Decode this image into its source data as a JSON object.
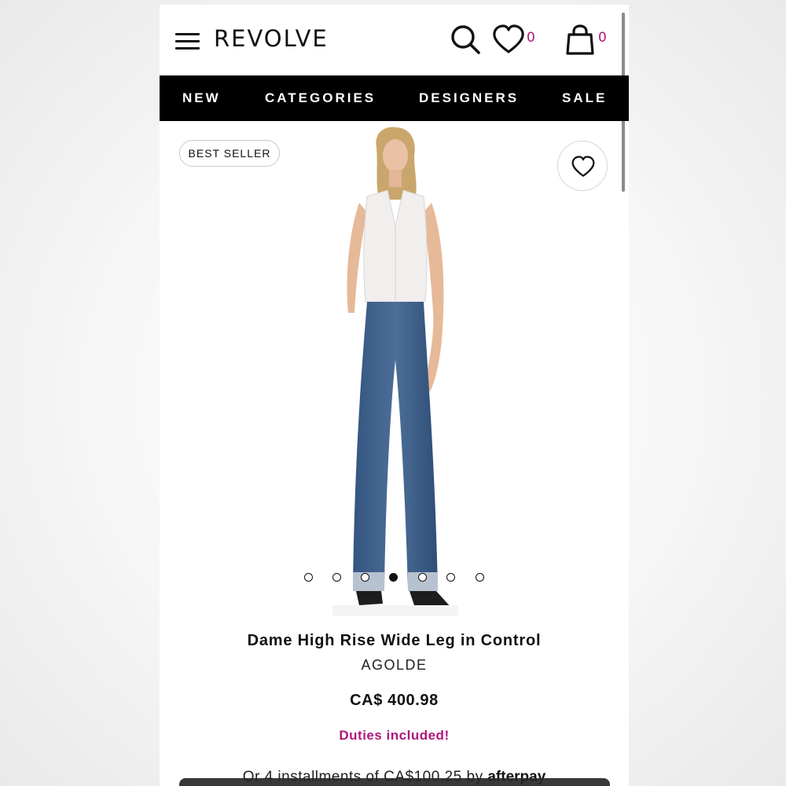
{
  "header": {
    "logo": "REVOLVE",
    "menu_icon": "hamburger-menu-icon",
    "search_icon": "search-icon",
    "wishlist_icon": "heart-icon",
    "wishlist_count": "0",
    "bag_icon": "shopping-bag-icon",
    "bag_count": "0",
    "count_color": "#b0177b"
  },
  "nav": {
    "items": [
      {
        "label": "NEW"
      },
      {
        "label": "CATEGORIES"
      },
      {
        "label": "DESIGNERS"
      },
      {
        "label": "SALE"
      }
    ]
  },
  "product": {
    "badge": "BEST SELLER",
    "favorite_icon": "heart-outline-icon",
    "image_description_icon": "product-photo",
    "title": "Dame High Rise Wide Leg in Control",
    "brand": "AGOLDE",
    "price": "CA$ 400.98",
    "duties": "Duties included!",
    "installments_text": "Or 4 installments of CA$100.25 by ",
    "installments_provider": "afterpay",
    "carousel": {
      "count": 7,
      "active_index": 3
    }
  },
  "colors": {
    "accent": "#b0177b",
    "nav_bg": "#000000",
    "text": "#111111"
  }
}
